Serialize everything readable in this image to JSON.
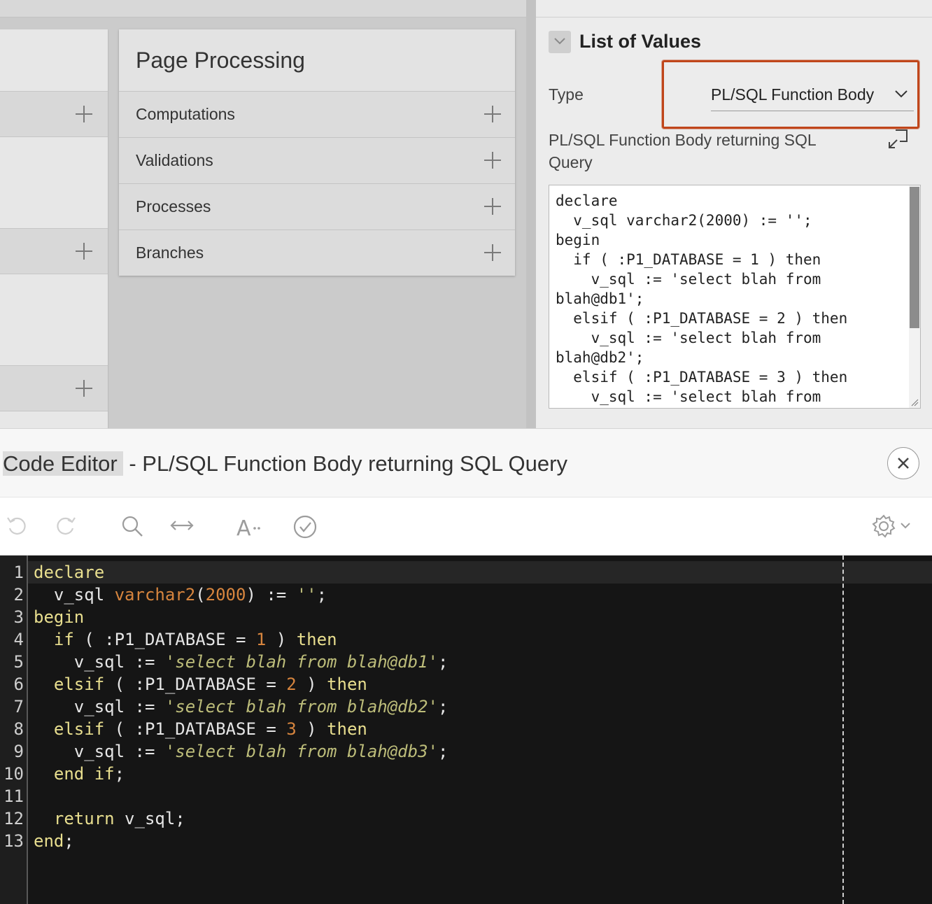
{
  "page_processing": {
    "title": "Page Processing",
    "rows": [
      "Computations",
      "Validations",
      "Processes",
      "Branches"
    ]
  },
  "properties": {
    "section_title": "List of Values",
    "type_label": "Type",
    "type_value": "PL/SQL Function Body",
    "code_label": "PL/SQL Function Body returning SQL Query",
    "code_text": "declare\n  v_sql varchar2(2000) := '';\nbegin\n  if ( :P1_DATABASE = 1 ) then\n    v_sql := 'select blah from\nblah@db1';\n  elsif ( :P1_DATABASE = 2 ) then\n    v_sql := 'select blah from\nblah@db2';\n  elsif ( :P1_DATABASE = 3 ) then\n    v_sql := 'select blah from"
  },
  "editor": {
    "title_prefix": "Code Editor",
    "title_suffix": " - PL/SQL Function Body returning SQL Query",
    "line_numbers": [
      "1",
      "2",
      "3",
      "4",
      "5",
      "6",
      "7",
      "8",
      "9",
      "10",
      "11",
      "12",
      "13"
    ],
    "code_lines": [
      [
        {
          "t": "declare",
          "c": "kw"
        }
      ],
      [
        {
          "t": "  v_sql ",
          "c": ""
        },
        {
          "t": "varchar2",
          "c": "num"
        },
        {
          "t": "(",
          "c": ""
        },
        {
          "t": "2000",
          "c": "num"
        },
        {
          "t": ") := ",
          "c": ""
        },
        {
          "t": "''",
          "c": "q"
        },
        {
          "t": ";",
          "c": ""
        }
      ],
      [
        {
          "t": "begin",
          "c": "kw"
        }
      ],
      [
        {
          "t": "  ",
          "c": ""
        },
        {
          "t": "if",
          "c": "kw"
        },
        {
          "t": " ( :P1_DATABASE = ",
          "c": ""
        },
        {
          "t": "1",
          "c": "num"
        },
        {
          "t": " ) ",
          "c": ""
        },
        {
          "t": "then",
          "c": "kw"
        }
      ],
      [
        {
          "t": "    v_sql := ",
          "c": ""
        },
        {
          "t": "'",
          "c": "q"
        },
        {
          "t": "select blah from blah@db1",
          "c": "str"
        },
        {
          "t": "'",
          "c": "q"
        },
        {
          "t": ";",
          "c": ""
        }
      ],
      [
        {
          "t": "  ",
          "c": ""
        },
        {
          "t": "elsif",
          "c": "kw"
        },
        {
          "t": " ( :P1_DATABASE = ",
          "c": ""
        },
        {
          "t": "2",
          "c": "num"
        },
        {
          "t": " ) ",
          "c": ""
        },
        {
          "t": "then",
          "c": "kw"
        }
      ],
      [
        {
          "t": "    v_sql := ",
          "c": ""
        },
        {
          "t": "'",
          "c": "q"
        },
        {
          "t": "select blah from blah@db2",
          "c": "str"
        },
        {
          "t": "'",
          "c": "q"
        },
        {
          "t": ";",
          "c": ""
        }
      ],
      [
        {
          "t": "  ",
          "c": ""
        },
        {
          "t": "elsif",
          "c": "kw"
        },
        {
          "t": " ( :P1_DATABASE = ",
          "c": ""
        },
        {
          "t": "3",
          "c": "num"
        },
        {
          "t": " ) ",
          "c": ""
        },
        {
          "t": "then",
          "c": "kw"
        }
      ],
      [
        {
          "t": "    v_sql := ",
          "c": ""
        },
        {
          "t": "'",
          "c": "q"
        },
        {
          "t": "select blah from blah@db3",
          "c": "str"
        },
        {
          "t": "'",
          "c": "q"
        },
        {
          "t": ";",
          "c": ""
        }
      ],
      [
        {
          "t": "  ",
          "c": ""
        },
        {
          "t": "end",
          "c": "kw"
        },
        {
          "t": " ",
          "c": ""
        },
        {
          "t": "if",
          "c": "kw"
        },
        {
          "t": ";",
          "c": ""
        }
      ],
      [
        {
          "t": "",
          "c": ""
        }
      ],
      [
        {
          "t": "  ",
          "c": ""
        },
        {
          "t": "return",
          "c": "kw"
        },
        {
          "t": " v_sql;",
          "c": ""
        }
      ],
      [
        {
          "t": "end",
          "c": "kw"
        },
        {
          "t": ";",
          "c": ""
        }
      ]
    ],
    "toolbar_icons": [
      "undo-icon",
      "redo-icon",
      "search-icon",
      "replace-icon",
      "autocomplete-icon",
      "validate-icon",
      "settings-icon"
    ]
  },
  "colors": {
    "highlight": "#c0461b",
    "keyword": "#e9df8f",
    "number": "#d7853e",
    "string": "#bdbd7a",
    "editor_bg": "#151515"
  }
}
